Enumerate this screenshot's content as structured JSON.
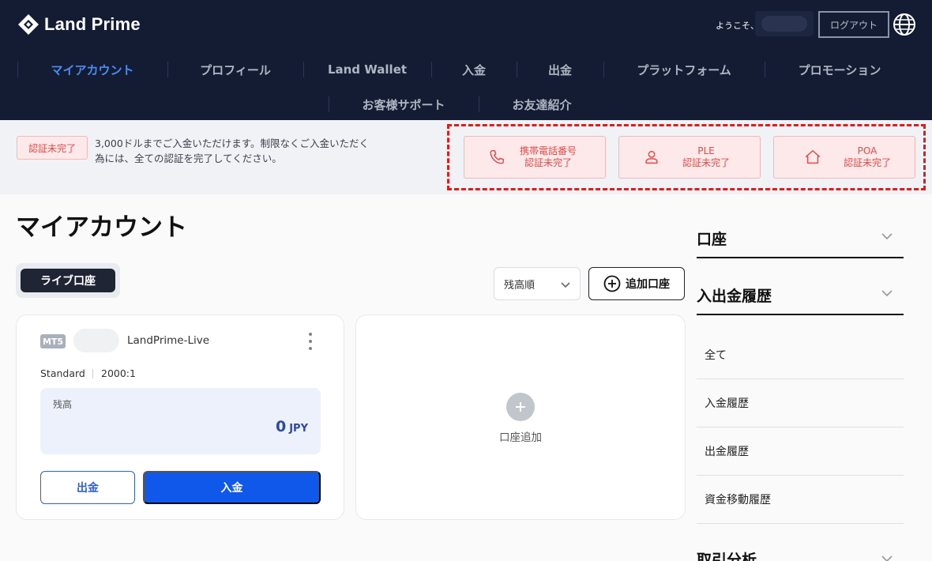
{
  "brand": {
    "name": "Land Prime"
  },
  "header": {
    "welcome": "ようこそ、",
    "logout_label": "ログアウト",
    "globe_icon": "globe-icon"
  },
  "nav": {
    "row1": [
      "マイアカウント",
      "プロフィール",
      "Land Wallet",
      "入金",
      "出金",
      "プラットフォーム",
      "プロモーション"
    ],
    "row2": [
      "お客様サポート",
      "お友達紹介"
    ],
    "active_color": "#4b8df8"
  },
  "banner": {
    "status_badge": "認証未完了",
    "message": "3,000ドルまでご入金いただけます。制限なくご入金いただく為には、全ての認証を完了してください。",
    "cards": [
      {
        "icon": "phone-icon",
        "title": "携帯電話番号",
        "status": "認証未完了"
      },
      {
        "icon": "user-icon",
        "title": "PLE",
        "status": "認証未完了"
      },
      {
        "icon": "home-icon",
        "title": "POA",
        "status": "認証未完了"
      }
    ]
  },
  "main": {
    "page_title": "マイアカウント",
    "tab_live": "ライブ口座",
    "sort_value": "残高順",
    "add_account_label": "追加口座"
  },
  "account": {
    "platform_badge": "MT5",
    "server": "LandPrime-Live",
    "type": "Standard",
    "leverage": "2000:1",
    "balance_label": "残高",
    "balance": "0",
    "currency": "JPY",
    "withdraw_label": "出金",
    "deposit_label": "入金"
  },
  "add_card": {
    "label": "口座追加"
  },
  "sidebar": {
    "section_account": "口座",
    "section_history": "入出金履歴",
    "history_items": [
      "全て",
      "入金履歴",
      "出金履歴",
      "資金移動履歴"
    ],
    "section_analysis": "取引分析"
  },
  "colors": {
    "header_bg": "#141c33",
    "alert_red": "#e34b4b",
    "primary_blue": "#1058ea"
  }
}
